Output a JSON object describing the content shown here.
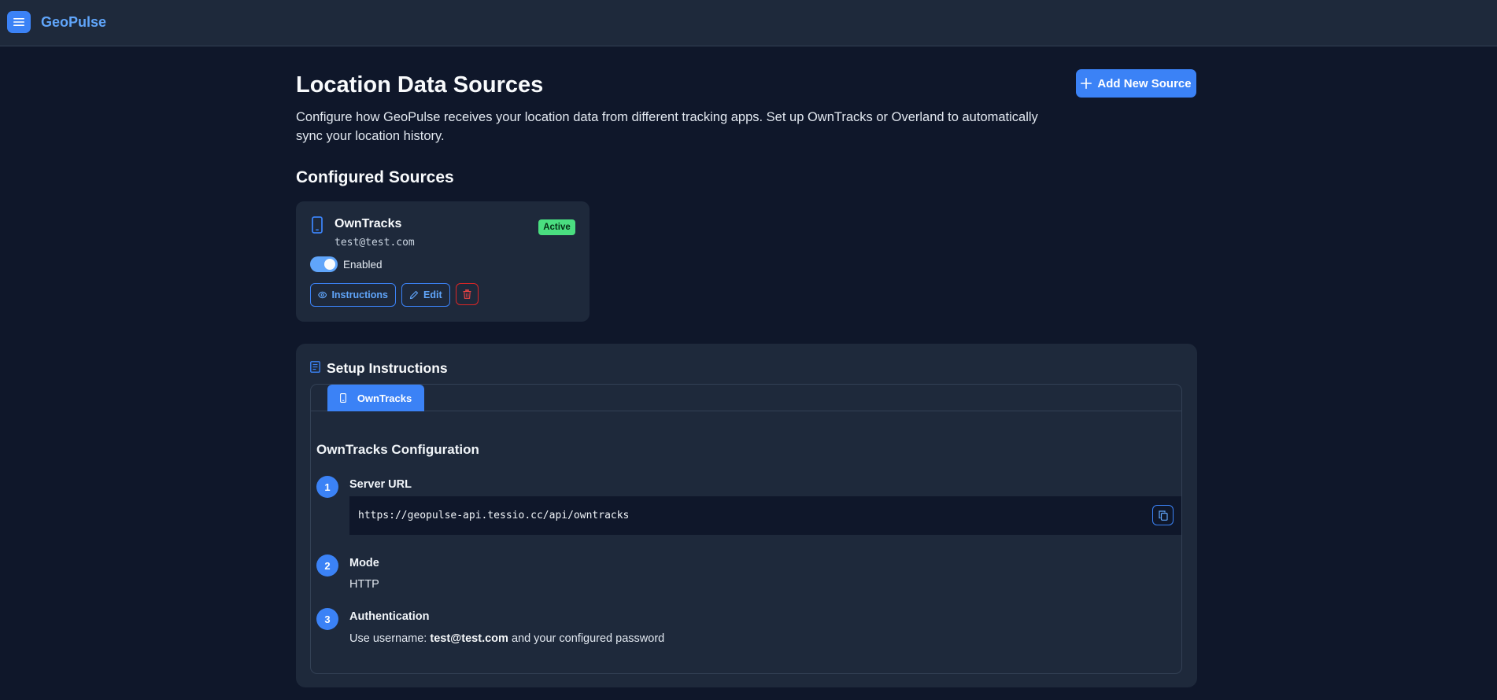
{
  "app": {
    "brand": "GeoPulse",
    "menu_icon": "hamburger-icon"
  },
  "header": {
    "title": "Location Data Sources",
    "description": "Configure how GeoPulse receives your location data from different tracking apps. Set up OwnTracks or Overland to automatically sync your location history.",
    "add_button_label": "Add New Source"
  },
  "configured": {
    "section_title": "Configured Sources",
    "sources": [
      {
        "name": "OwnTracks",
        "username": "test@test.com",
        "status": "Active",
        "toggle_label": "Enabled",
        "toggle_on": true,
        "instructions_label": "Instructions",
        "edit_label": "Edit"
      }
    ]
  },
  "setup": {
    "title": "Setup Instructions",
    "tabs": [
      {
        "label": "OwnTracks",
        "active": true
      }
    ],
    "config_title": "OwnTracks Configuration",
    "steps": [
      {
        "num": "1",
        "title": "Server URL",
        "value": "https://geopulse-api.tessio.cc/api/owntracks"
      },
      {
        "num": "2",
        "title": "Mode",
        "value": "HTTP"
      },
      {
        "num": "3",
        "title": "Authentication",
        "prefix": "Use username:",
        "username": "test@test.com",
        "suffix": "and your configured password"
      }
    ]
  },
  "colors": {
    "accent": "#3b82f6",
    "active_badge": "#4ade80",
    "delete": "#dc2626",
    "background": "#0f172a",
    "panel": "#1e293b"
  }
}
